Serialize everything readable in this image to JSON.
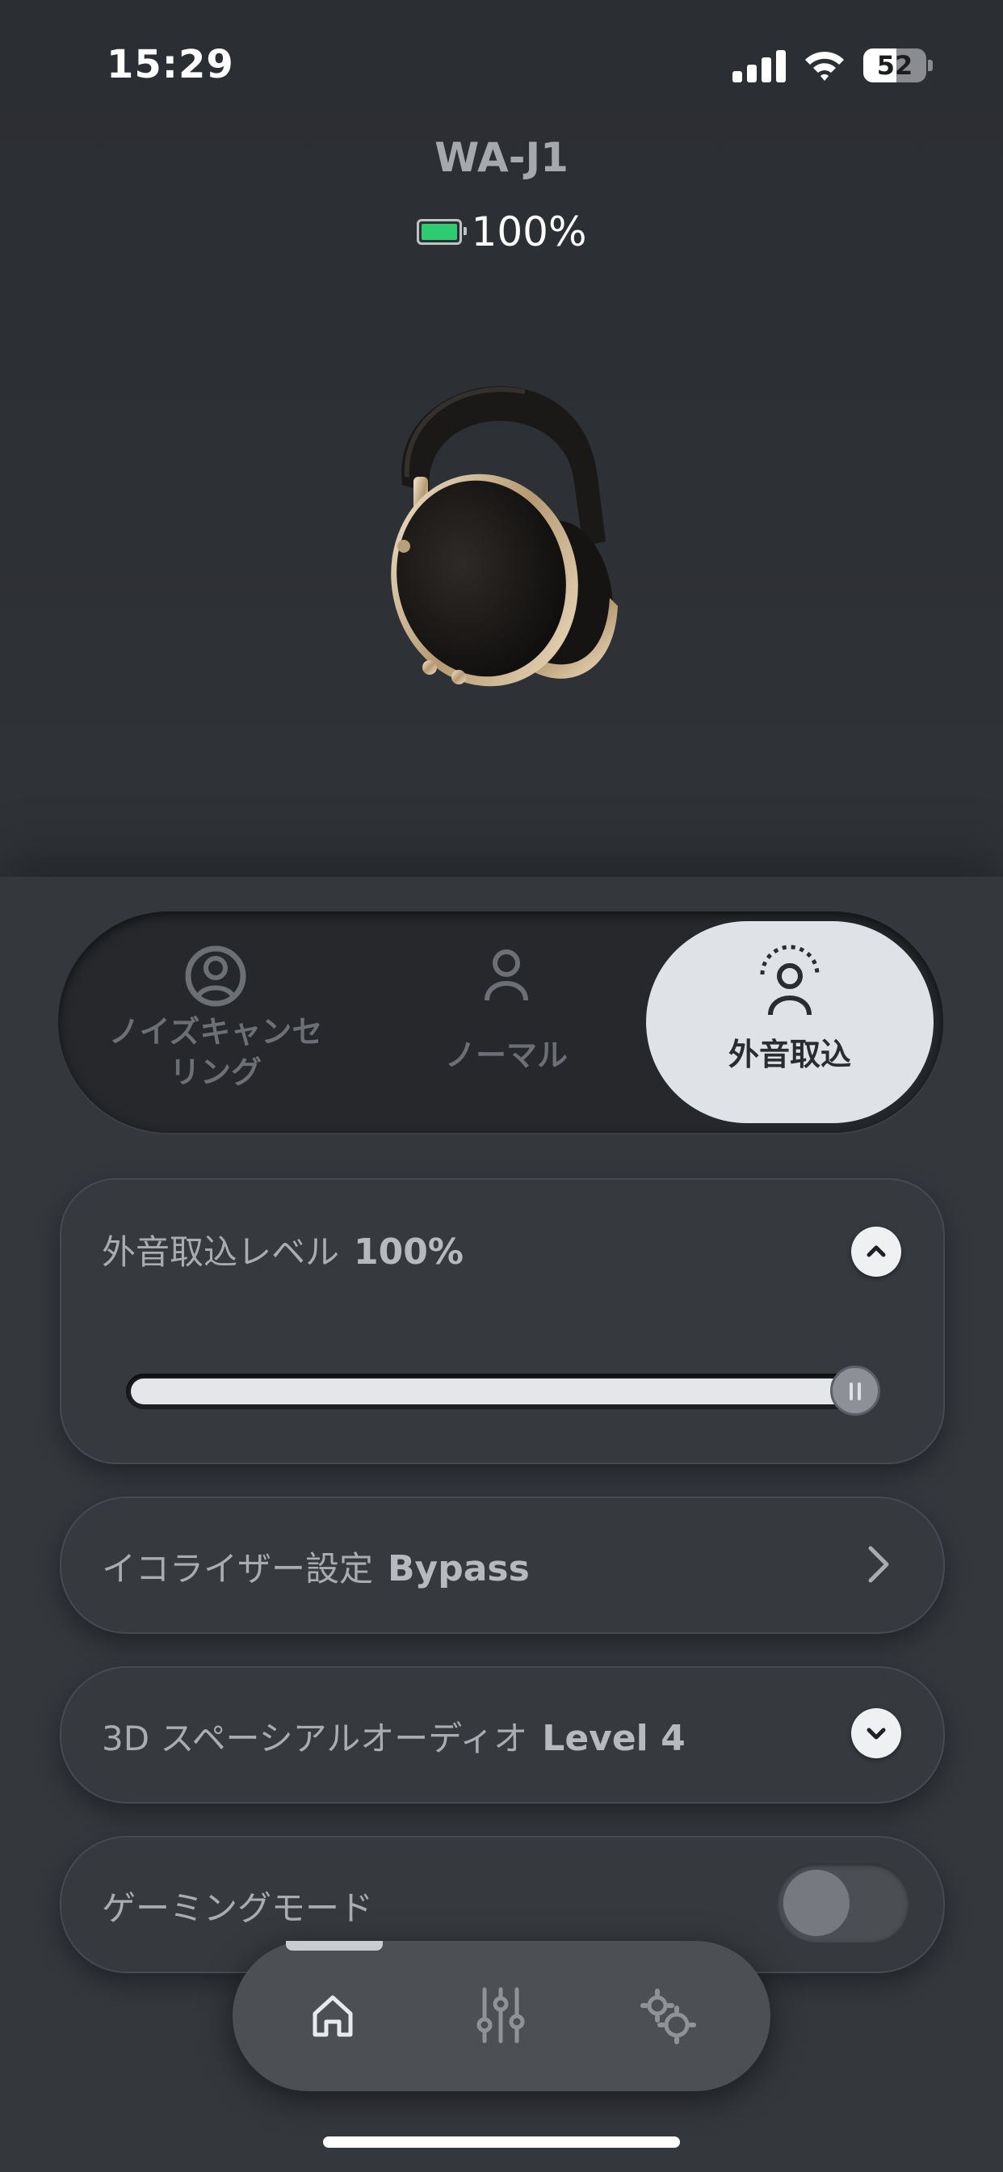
{
  "status_bar": {
    "time": "15:29",
    "battery_percent": "52",
    "battery_level": 0.52
  },
  "device": {
    "name": "WA-J1",
    "battery": "100%"
  },
  "modes": [
    {
      "label": "ノイズキャンセ\nリング",
      "icon": "noise-cancel-icon",
      "selected": false
    },
    {
      "label": "ノーマル",
      "icon": "person-icon",
      "selected": false
    },
    {
      "label": "外音取込",
      "icon": "ambient-person-icon",
      "selected": true
    }
  ],
  "ambient_level": {
    "label": "外音取込レベル",
    "value": "100%",
    "level": 1.0,
    "expanded": true
  },
  "equalizer": {
    "label": "イコライザー設定",
    "value": "Bypass"
  },
  "spatial_audio": {
    "label": "3D スペーシアルオーディオ",
    "value": "Level 4",
    "expanded": false
  },
  "gaming_mode": {
    "label": "ゲーミングモード",
    "enabled": false
  },
  "nav": {
    "items": [
      "home-icon",
      "equalizer-icon",
      "settings-icon"
    ],
    "active": 0
  },
  "colors": {
    "background": "#2b2e33",
    "card": "#36393e",
    "selected_mode": "#dfe2e6",
    "battery_green": "#2ecc71"
  }
}
